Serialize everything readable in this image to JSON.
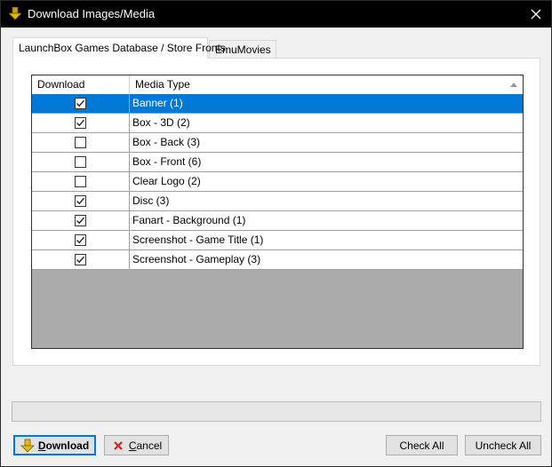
{
  "window": {
    "title": "Download Images/Media",
    "icon": "download-arrow-icon"
  },
  "tabs": [
    {
      "label": "LaunchBox Games Database / Store Fronts",
      "active": true
    },
    {
      "label": "EmuMovies",
      "active": false
    }
  ],
  "grid": {
    "columns": [
      "Download",
      "Media Type"
    ],
    "sort_icon": "sort-ascending-icon",
    "rows": [
      {
        "checked": true,
        "media_type": "Banner (1)",
        "selected": true
      },
      {
        "checked": true,
        "media_type": "Box - 3D (2)",
        "selected": false
      },
      {
        "checked": false,
        "media_type": "Box - Back (3)",
        "selected": false
      },
      {
        "checked": false,
        "media_type": "Box - Front (6)",
        "selected": false
      },
      {
        "checked": false,
        "media_type": "Clear Logo (2)",
        "selected": false
      },
      {
        "checked": true,
        "media_type": "Disc (3)",
        "selected": false
      },
      {
        "checked": true,
        "media_type": "Fanart - Background (1)",
        "selected": false
      },
      {
        "checked": true,
        "media_type": "Screenshot - Game Title (1)",
        "selected": false
      },
      {
        "checked": true,
        "media_type": "Screenshot - Gameplay (3)",
        "selected": false
      }
    ]
  },
  "progress": {
    "value": 0
  },
  "buttons": {
    "download": {
      "label_first": "D",
      "label_rest": "ownload",
      "icon": "download-arrow-icon"
    },
    "cancel": {
      "label_first": "C",
      "label_rest": "ancel",
      "icon": "red-x-icon"
    },
    "check_all": "Check All",
    "uncheck_all": "Uncheck All"
  },
  "colors": {
    "selection": "#0078d7",
    "grid_empty": "#ababab",
    "titlebar": "#000000"
  }
}
